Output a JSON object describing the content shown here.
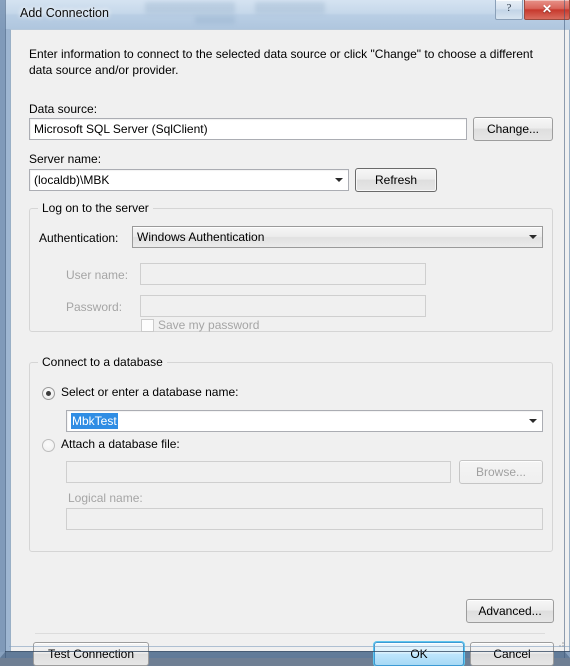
{
  "window": {
    "title": "Add Connection",
    "help_glyph": "?",
    "close_glyph": "✕"
  },
  "intro": {
    "text": "Enter information to connect to the selected data source or click \"Change\" to choose a different data source and/or provider."
  },
  "data_source": {
    "label": "Data source:",
    "value": "Microsoft SQL Server (SqlClient)",
    "change_button": "Change..."
  },
  "server": {
    "label": "Server name:",
    "value": "(localdb)\\MBK",
    "refresh_button": "Refresh"
  },
  "logon": {
    "group_title": "Log on to the server",
    "authentication_label": "Authentication:",
    "authentication_value": "Windows Authentication",
    "username_label": "User name:",
    "username_value": "",
    "password_label": "Password:",
    "password_value": "",
    "save_password_label": "Save my password"
  },
  "database": {
    "group_title": "Connect to a database",
    "select_radio_label": "Select or enter a database name:",
    "select_radio_checked": true,
    "database_name_value": "MbkTest",
    "attach_radio_label": "Attach a database file:",
    "attach_radio_checked": false,
    "attach_file_value": "",
    "browse_button": "Browse...",
    "logical_name_label": "Logical name:",
    "logical_name_value": ""
  },
  "footer": {
    "advanced_button": "Advanced...",
    "test_connection_button": "Test Connection",
    "ok_button": "OK",
    "cancel_button": "Cancel"
  },
  "colors": {
    "accent_selection": "#2f8de4",
    "default_button_border": "#3c9ad4",
    "close_button": "#c7392d"
  }
}
